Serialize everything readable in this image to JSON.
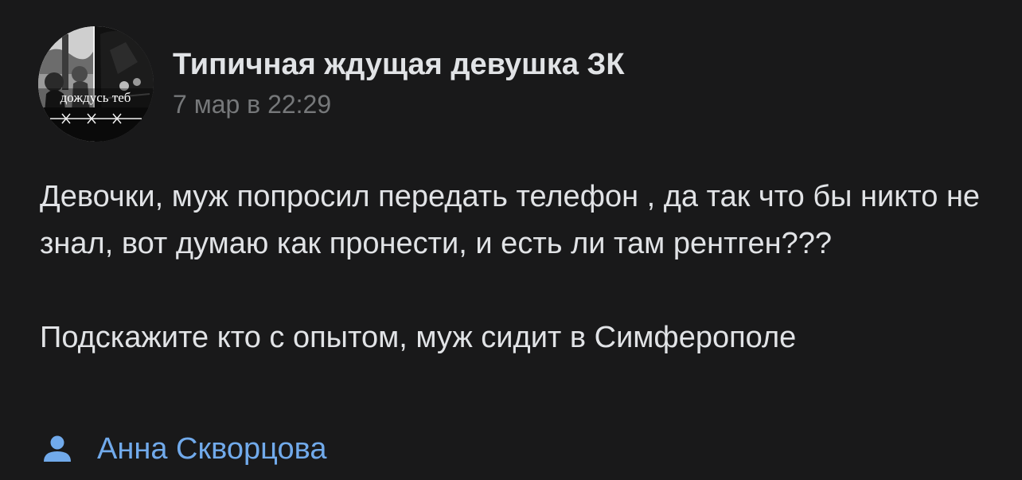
{
  "post": {
    "group_name": "Типичная ждущая девушка ЗК",
    "date": "7 мар в 22:29",
    "avatar_caption": "дождусь теб",
    "paragraphs": [
      "Девочки, муж попросил передать телефон , да так что бы никто не знал, вот думаю как пронести, и есть ли там рентген???",
      "Подскажите кто с опытом, муж сидит в Симферополе"
    ],
    "author": {
      "icon": "user-icon",
      "name": "Анна Скворцова"
    }
  },
  "colors": {
    "background": "#19191a",
    "text": "#e1e3e6",
    "secondary_text": "#76787a",
    "accent": "#71aaeb"
  }
}
